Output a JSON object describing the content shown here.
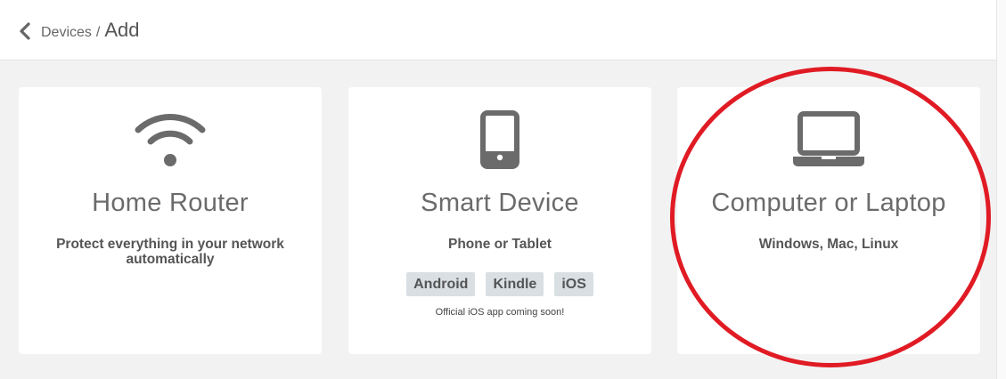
{
  "header": {
    "breadcrumb_parent": "Devices",
    "breadcrumb_separator": "/",
    "breadcrumb_current": "Add",
    "back_icon": "chevron-left-icon"
  },
  "cards": [
    {
      "icon": "wifi-icon",
      "title": "Home Router",
      "subtitle": "Protect everything in your network automatically"
    },
    {
      "icon": "smartphone-icon",
      "title": "Smart Device",
      "subtitle": "Phone or Tablet",
      "tags": [
        "Android",
        "Kindle",
        "iOS"
      ],
      "note": "Official iOS app coming soon!"
    },
    {
      "icon": "laptop-icon",
      "title": "Computer or Laptop",
      "subtitle": "Windows, Mac, Linux"
    }
  ],
  "colors": {
    "background": "#f2f2f2",
    "card": "#ffffff",
    "icon": "#6b6b6b",
    "tag": "#d9dfe3",
    "highlight": "#e01b24"
  }
}
